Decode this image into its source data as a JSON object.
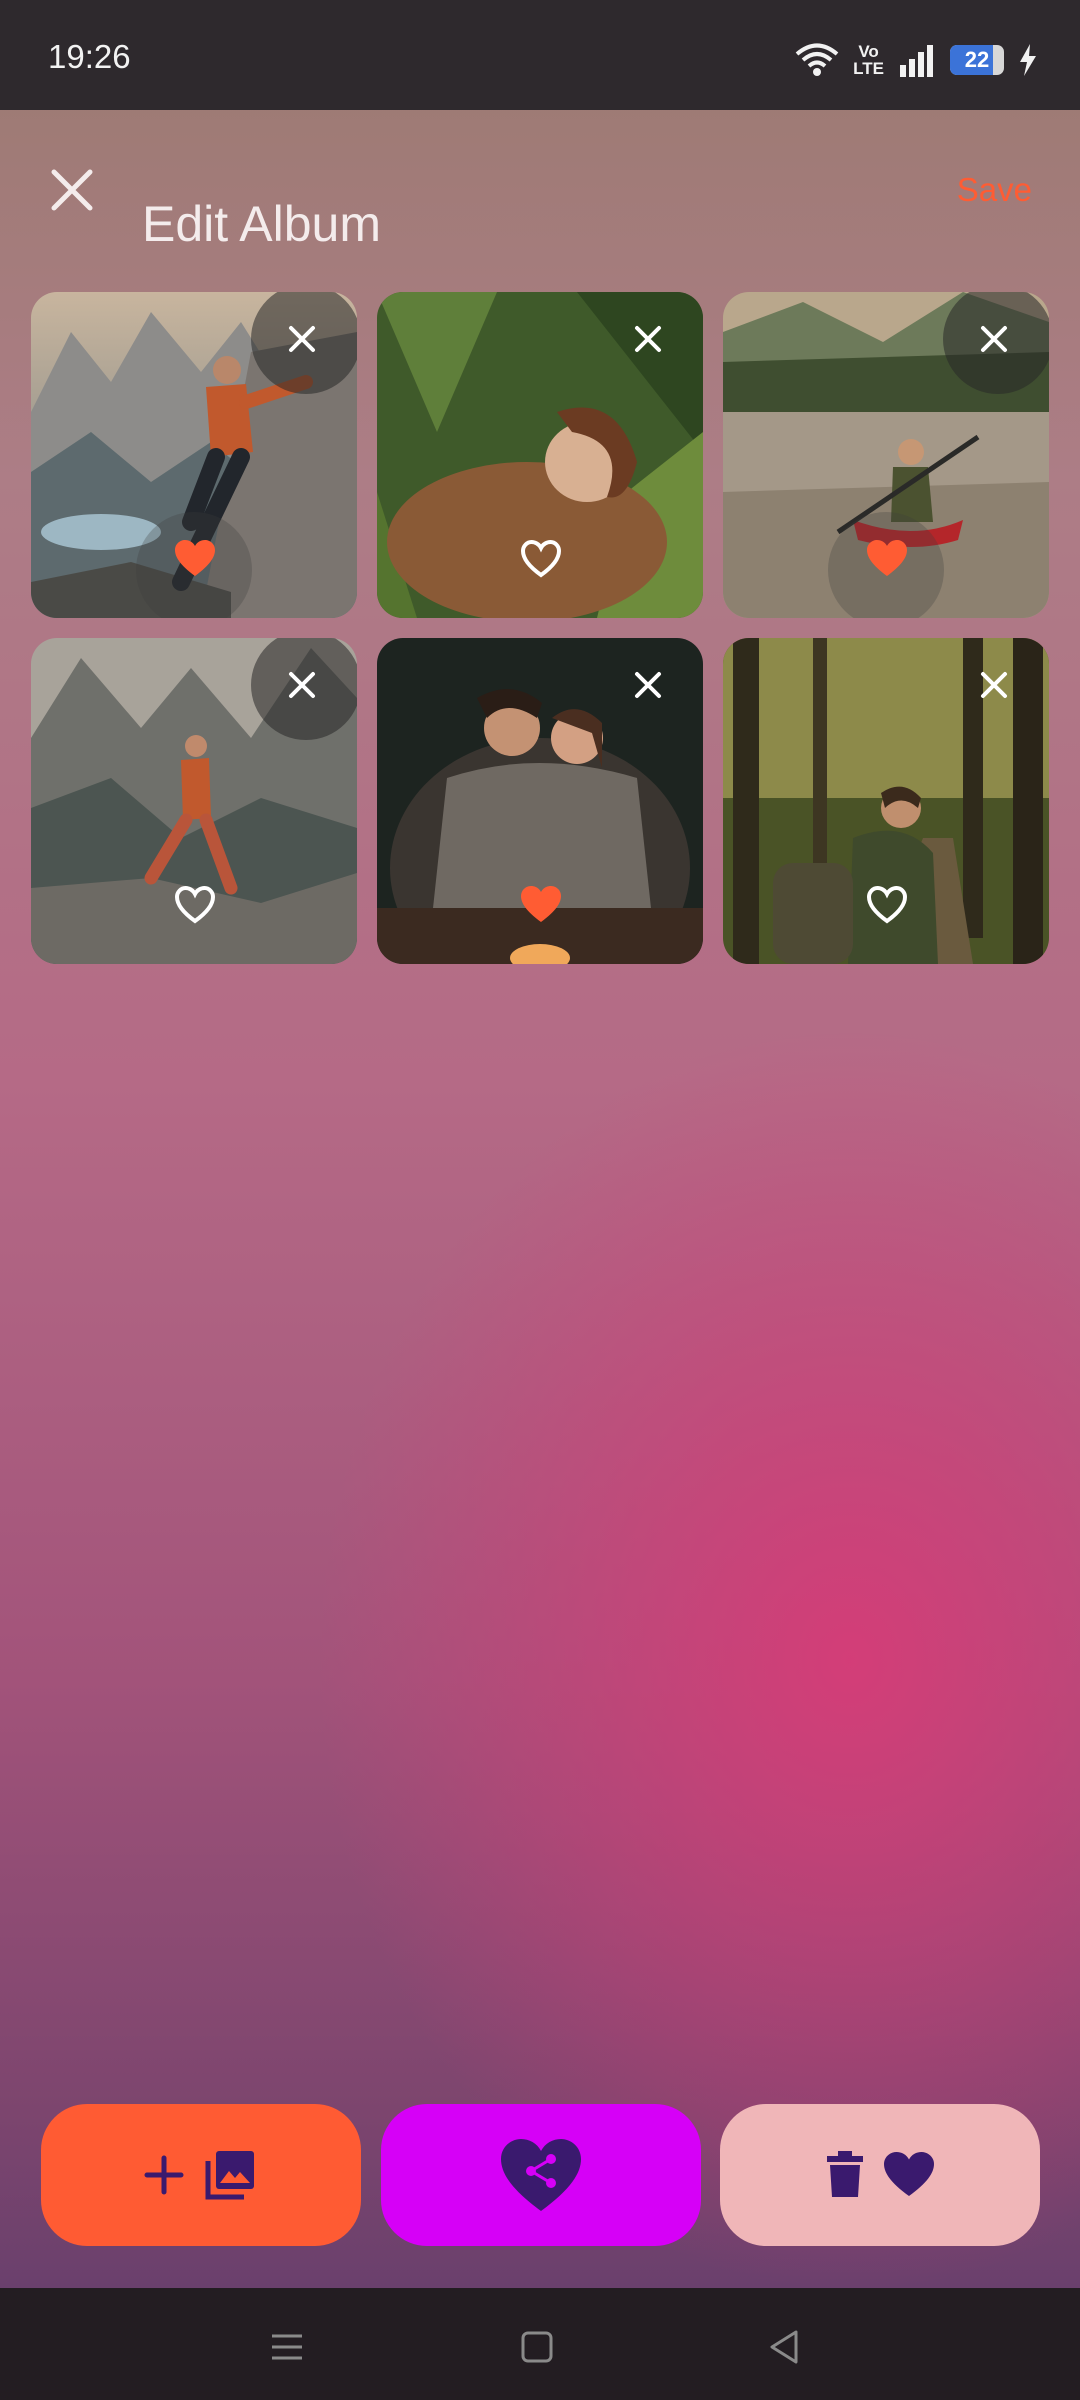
{
  "status_bar": {
    "time": "19:26",
    "network_label_top": "Vo",
    "network_label_bottom": "LTE",
    "battery_level": 22,
    "battery_text": "22",
    "icons": [
      "wifi-icon",
      "volte-icon",
      "signal-icon",
      "battery-icon",
      "charging-icon"
    ]
  },
  "header": {
    "title": "Edit Album",
    "save_label": "Save",
    "close_icon": "close-icon"
  },
  "photos": [
    {
      "subject": "climber",
      "favorite": true
    },
    {
      "subject": "woman-in-ferns",
      "favorite": false
    },
    {
      "subject": "kayaker",
      "favorite": true
    },
    {
      "subject": "mountain-runner",
      "favorite": false
    },
    {
      "subject": "couple-by-campfire",
      "favorite": true
    },
    {
      "subject": "forest-hiker",
      "favorite": false
    }
  ],
  "actions": {
    "add": {
      "icons": [
        "plus-icon",
        "photo-library-icon"
      ]
    },
    "share": {
      "icons": [
        "heart-share-icon"
      ]
    },
    "delete": {
      "icons": [
        "trash-icon",
        "heart-icon"
      ]
    }
  },
  "colors": {
    "accent": "#ff5c33",
    "share": "#d600f7",
    "delete_bg": "#f0b6b8",
    "icon_dark": "#3a1a6e"
  },
  "nav_bar": [
    "menu-icon",
    "home-icon",
    "back-icon"
  ]
}
